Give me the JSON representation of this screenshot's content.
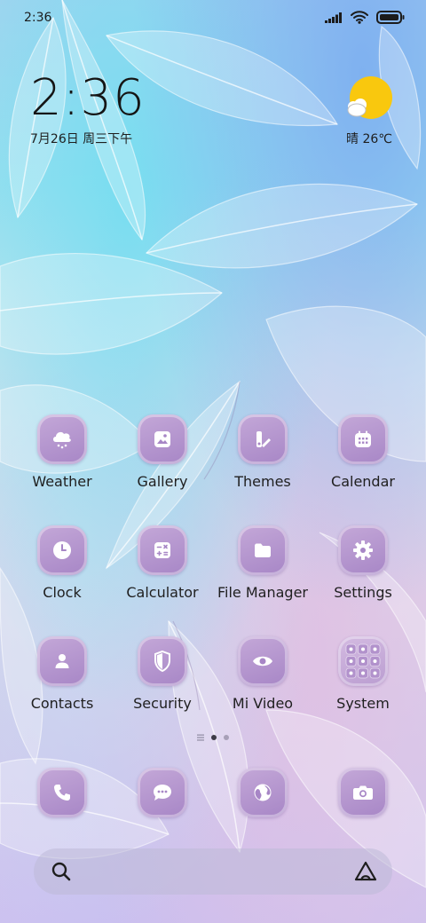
{
  "status_bar": {
    "time": "2:36",
    "icons": [
      "signal-icon",
      "wifi-icon",
      "battery-icon"
    ]
  },
  "clock_widget": {
    "time": "2:36",
    "date": "7月26日 周三下午"
  },
  "weather_widget": {
    "icon": "sun-cloud-icon",
    "text": "晴 26℃"
  },
  "apps": [
    {
      "label": "Weather",
      "icon": "cloud-rain-icon"
    },
    {
      "label": "Gallery",
      "icon": "image-icon"
    },
    {
      "label": "Themes",
      "icon": "brush-palette-icon"
    },
    {
      "label": "Calendar",
      "icon": "calendar-icon"
    },
    {
      "label": "Clock",
      "icon": "clock-icon"
    },
    {
      "label": "Calculator",
      "icon": "calculator-icon"
    },
    {
      "label": "File Manager",
      "icon": "folder-icon"
    },
    {
      "label": "Settings",
      "icon": "gear-icon"
    },
    {
      "label": "Contacts",
      "icon": "person-icon"
    },
    {
      "label": "Security",
      "icon": "shield-icon"
    },
    {
      "label": "Mi Video",
      "icon": "eye-icon"
    },
    {
      "label": "System",
      "icon": "folder-grid-icon"
    }
  ],
  "pager": {
    "pages": 2,
    "active_page": 1
  },
  "dock": [
    {
      "icon": "phone-icon"
    },
    {
      "icon": "message-icon"
    },
    {
      "icon": "browser-globe-icon"
    },
    {
      "icon": "camera-icon"
    }
  ],
  "search_bar": {
    "left_icon": "search-icon",
    "right_icon": "assistant-icon"
  },
  "colors": {
    "app_icon_top": "#c4a8d8",
    "app_icon_bottom": "#a786c6",
    "sun": "#f9c80e"
  }
}
